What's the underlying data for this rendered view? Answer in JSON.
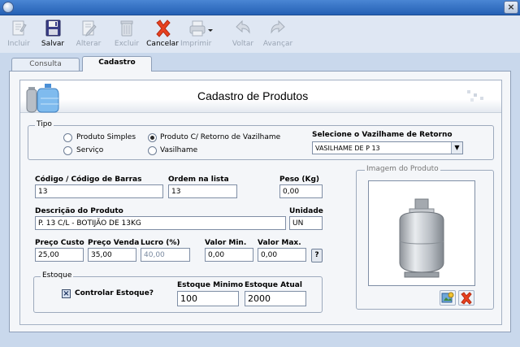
{
  "window": {
    "close_glyph": "×"
  },
  "toolbar": {
    "items": [
      {
        "label": "Incluir",
        "icon": "add-document-icon",
        "enabled": false
      },
      {
        "label": "Salvar",
        "icon": "floppy-disk-icon",
        "enabled": true
      },
      {
        "label": "Alterar",
        "icon": "edit-document-icon",
        "enabled": false
      },
      {
        "label": "Excluir",
        "icon": "trash-icon",
        "enabled": false
      },
      {
        "label": "Cancelar",
        "icon": "cancel-x-icon",
        "enabled": true
      },
      {
        "label": "Imprimir",
        "icon": "printer-icon",
        "enabled": false
      },
      {
        "label": "Voltar",
        "icon": "back-arrow-icon",
        "enabled": false
      },
      {
        "label": "Avançar",
        "icon": "forward-arrow-icon",
        "enabled": false
      }
    ]
  },
  "tabs": [
    {
      "label": "Consulta",
      "active": false
    },
    {
      "label": "Cadastro",
      "active": true
    }
  ],
  "header": {
    "title": "Cadastro de Produtos",
    "icon": "gas-cylinder-water-jug-icon"
  },
  "tipo": {
    "legend": "Tipo",
    "options": [
      {
        "label": "Produto Simples",
        "selected": false
      },
      {
        "label": "Produto C/ Retorno de Vazilhame",
        "selected": true
      },
      {
        "label": "Serviço",
        "selected": false
      },
      {
        "label": "Vasilhame",
        "selected": false
      }
    ],
    "vasilhame_label": "Selecione o Vazilhame de Retorno",
    "vasilhame_value": "VASILHAME DE P 13"
  },
  "fields": {
    "codigo_label": "Código / Código de  Barras",
    "codigo_value": "13",
    "ordem_label": "Ordem na lista",
    "ordem_value": "13",
    "peso_label": "Peso (Kg)",
    "peso_value": "0,00",
    "descricao_label": "Descrição do Produto",
    "descricao_value": "P. 13 C/L - BOTIJÃO DE 13KG",
    "unidade_label": "Unidade",
    "unidade_value": "UN",
    "preco_custo_label": "Preço Custo",
    "preco_custo_value": "25,00",
    "preco_venda_label": "Preço Venda",
    "preco_venda_value": "35,00",
    "lucro_label": "Lucro (%)",
    "lucro_value": "40,00",
    "valor_min_label": "Valor Min.",
    "valor_min_value": "0,00",
    "valor_max_label": "Valor Max.",
    "valor_max_value": "0,00",
    "help_button": "?"
  },
  "estoque": {
    "legend": "Estoque",
    "controlar_label": "Controlar Estoque?",
    "controlar_checked": true,
    "minimo_label": "Estoque Minimo",
    "minimo_value": "100",
    "atual_label": "Estoque Atual",
    "atual_value": "2000"
  },
  "imagem": {
    "legend": "Imagem do Produto",
    "image_icon": "gas-cylinder-image",
    "load_button_icon": "load-image-icon",
    "remove_button_icon": "remove-image-icon"
  },
  "colors": {
    "accent": "#2460b4",
    "cancel": "#e8411f",
    "toolbar_bg": "#dfe7f3"
  }
}
